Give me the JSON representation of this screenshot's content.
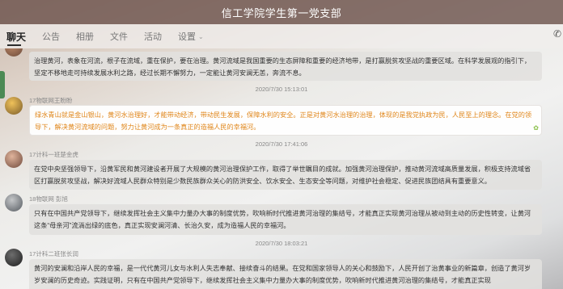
{
  "header": {
    "title": "信工学院学生第一党支部"
  },
  "tabs": [
    {
      "label": "聊天"
    },
    {
      "label": "公告"
    },
    {
      "label": "相册"
    },
    {
      "label": "文件"
    },
    {
      "label": "活动"
    },
    {
      "label": "设置"
    }
  ],
  "messages": [
    {
      "sender": "",
      "text": "治理黄河，表象在河流，根子在流域，重在保护，要在治理。黄河流域是我国重要的生态屏障和重要的经济地带，是打赢脱贫攻坚战的重要区域。在科学发展观的指引下，坚定不移地走可持续发展水利之路，经过长期不懈努力，一定能让黄河安澜无恙，奔流不息。"
    },
    {
      "time": "2020/7/30 15:13:01"
    },
    {
      "sender": "17物联网王盼盼",
      "text": "绿水青山就是金山银山，黄河水治理好，才能带动经济，带动民生发展，保障水利的安全。正是对黄河水治理的治理，体现的是我党执政为民，人民至上的理念。在党的领导下，解决黄河流域的问题，努力让黄河成为一条真正的造福人民的幸福河。",
      "style": "orange"
    },
    {
      "time": "2020/7/30 17:41:06"
    },
    {
      "sender": "17计科一班楚金虎",
      "text": "在党中央坚强领导下，沿黄军民和黄河建设者开展了大规模的黄河治理保护工作，取得了举世瞩目的成就。加强黄河治理保护，推动黄河流域高质量发展，积极支持流域省区打赢脱贫攻坚战，解决好流域人民群众特别是少数民族群众关心的防洪安全、饮水安全、生态安全等问题，对维护社会稳定、促进民族团结具有重要意义。"
    },
    {
      "sender": "18物联网 彭旭",
      "text": "只有在中国共产党领导下，继续发挥社会主义集中力量办大事的制度优势，吹响新时代推进黄河治理的集结号，才能真正实现黄河治理从被动到主动的历史性转变，让黄河这条“母亲河”流淌出绿的底色，真正实现安澜河清、长治久安，成为造福人民的幸福河。"
    },
    {
      "time": "2020/7/30 18:03:21"
    },
    {
      "sender": "17计科二班张长润",
      "text": "黄河的安澜和沿岸人民的幸福，是一代代黄河儿女与水利人失志奉献、接续奋斗的结果。在党和国家领导人的关心和鼓励下，人民开创了治黄事业的新篇章，创造了黄河岁岁安澜的历史奇迹。实践证明，只有在中国共产党领导下，继续发挥社会主义集中力量办大事的制度优势，吹响新时代推进黄河治理的集结号，才能真正实现"
    }
  ]
}
